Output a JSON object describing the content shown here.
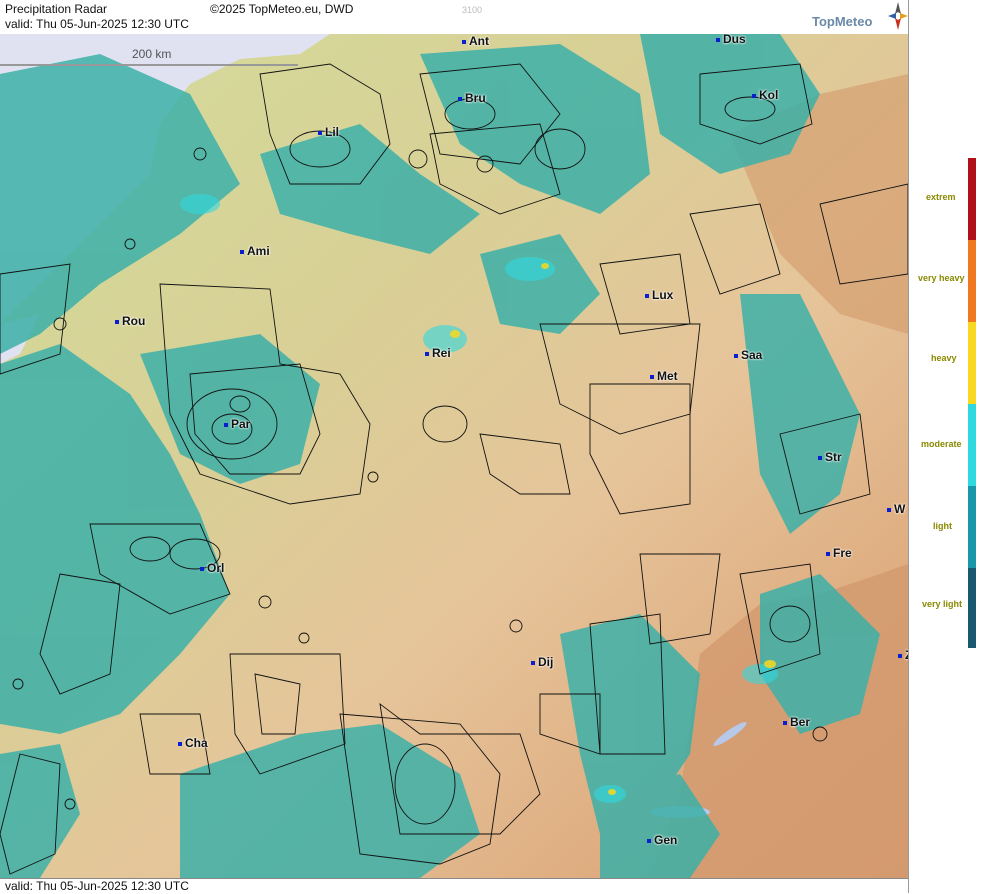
{
  "header": {
    "title": "Precipitation Radar",
    "copyright": "©2025 TopMeteo.eu, DWD",
    "valid": "valid:  Thu  05-Jun-2025 12:30 UTC",
    "code": "3100",
    "brand": "TopMeteo"
  },
  "scale": {
    "label": "200 km"
  },
  "cities": [
    {
      "label": "Ant"
    },
    {
      "label": "Dus"
    },
    {
      "label": "Bru"
    },
    {
      "label": "Kol"
    },
    {
      "label": "Lil"
    },
    {
      "label": "Ami"
    },
    {
      "label": "Lux"
    },
    {
      "label": "Rou"
    },
    {
      "label": "Rei"
    },
    {
      "label": "Saa"
    },
    {
      "label": "Met"
    },
    {
      "label": "Par"
    },
    {
      "label": "Str"
    },
    {
      "label": "W"
    },
    {
      "label": "Fre"
    },
    {
      "label": "Orl"
    },
    {
      "label": "Dij"
    },
    {
      "label": "Ber"
    },
    {
      "label": "Cha"
    },
    {
      "label": "Gen"
    },
    {
      "label": "Z"
    }
  ],
  "legend": {
    "items": [
      {
        "label": "extrem",
        "color": "#b0101a"
      },
      {
        "label": "very heavy",
        "color": "#f07820"
      },
      {
        "label": "heavy",
        "color": "#f8d820"
      },
      {
        "label": "moderate",
        "color": "#30d8e0"
      },
      {
        "label": "light",
        "color": "#1898a8"
      },
      {
        "label": "very light",
        "color": "#185870"
      }
    ]
  },
  "footer": {
    "valid": "valid:  Thu  05-Jun-2025 12:30 UTC"
  }
}
